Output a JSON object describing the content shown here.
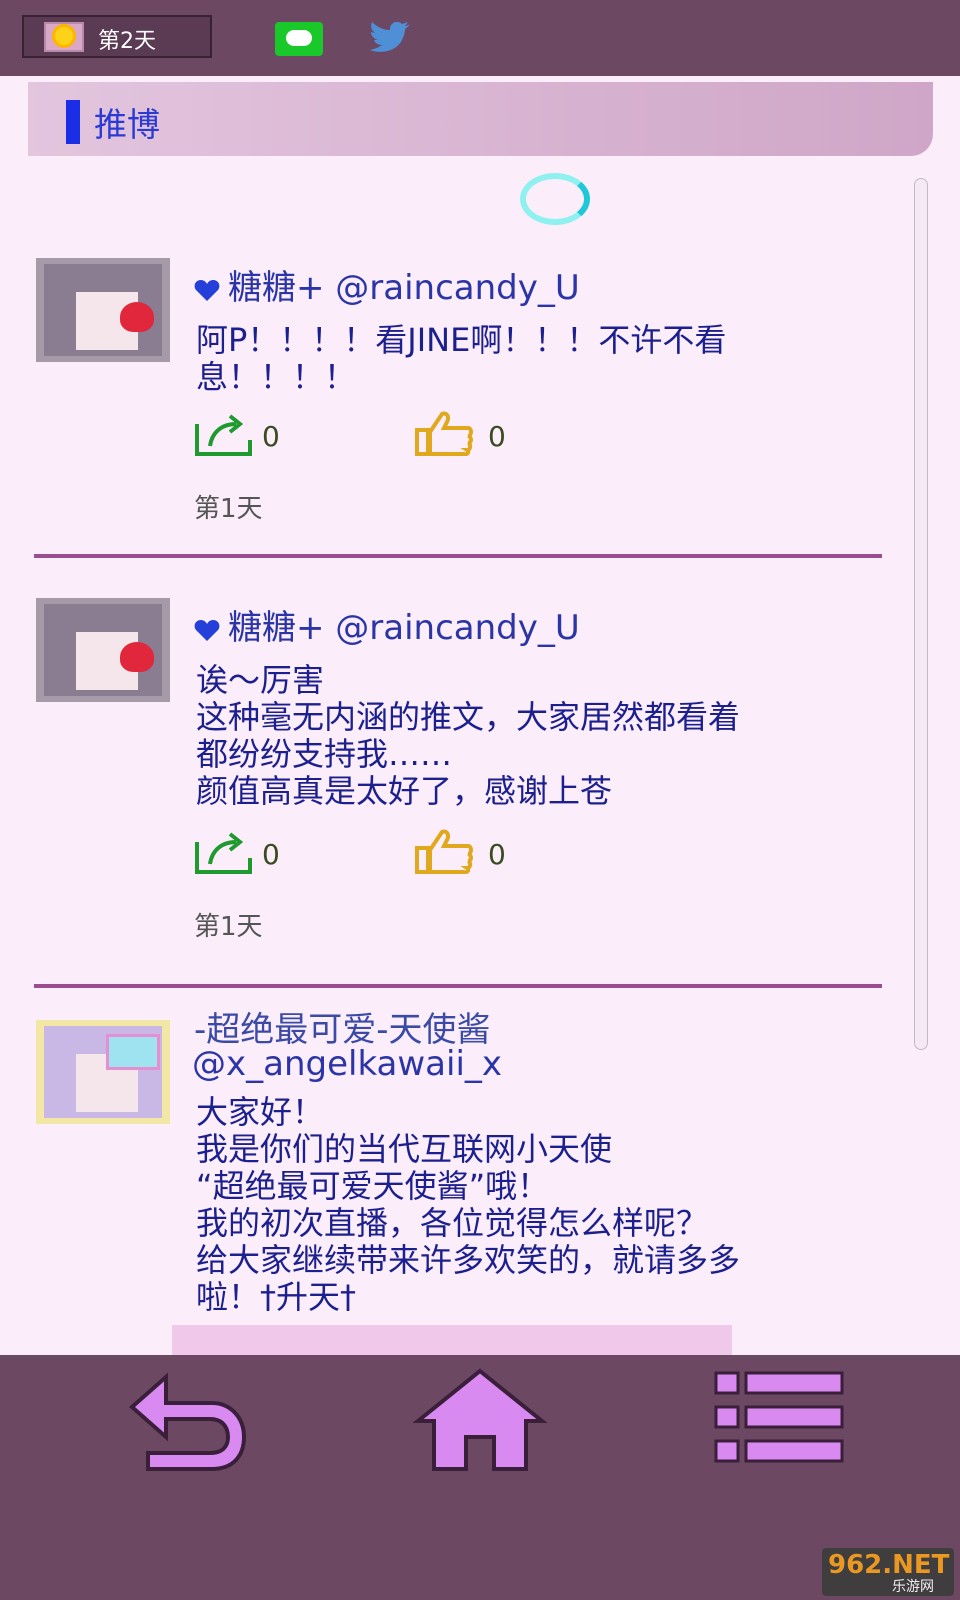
{
  "status": {
    "day": "第2天"
  },
  "header": {
    "title": "推博"
  },
  "posts": [
    {
      "author": "糖糖+ @raincandy_U",
      "body": "阿P！！！！看JINE啊！！！不许不看\n息！！！！",
      "shares": "0",
      "likes": "0",
      "time": "第1天"
    },
    {
      "author": "糖糖+ @raincandy_U",
      "body": "诶～厉害\n这种毫无内涵的推文，大家居然都看着\n都纷纷支持我……\n颜值高真是太好了，感谢上苍",
      "shares": "0",
      "likes": "0",
      "time": "第1天"
    },
    {
      "author_name": "-超绝最可爱-天使酱",
      "author_handle": "@x_angelkawaii_x",
      "body": "大家好！\n我是你们的当代互联网小天使\n“超绝最可爱天使酱”哦！\n我的初次直播，各位觉得怎么样呢？\n给大家继续带来许多欢笑的，就请多多\n啦！†升天†"
    }
  ],
  "watermark": {
    "logo": "962.NET",
    "sub": "乐游网"
  },
  "colors": {
    "bar": "#6c4863",
    "background": "#fbeefa",
    "accent_blue": "#2a3ad6",
    "share_green": "#1e9a2e",
    "like_gold": "#e0a81c",
    "nav_icon": "#d98af0"
  },
  "icons": [
    "sun-icon",
    "line-app-icon",
    "twitter-icon",
    "loading-icon",
    "heart-icon",
    "share-icon",
    "thumbs-up-icon",
    "back-icon",
    "home-icon",
    "menu-icon"
  ]
}
